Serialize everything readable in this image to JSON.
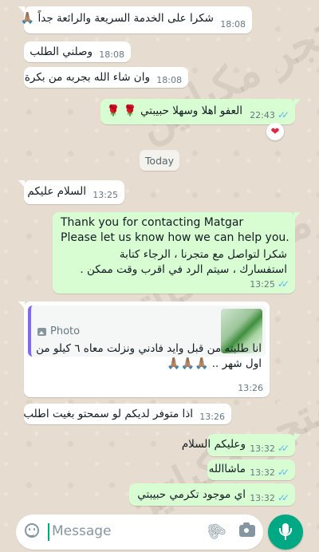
{
  "watermark": "متجر مكياتين",
  "messages": {
    "m1": {
      "text": "شكرا على الخدمة السريعة والرائعة جداً",
      "emoji": "🙏🏽",
      "time": "18:08"
    },
    "m2": {
      "text": "وصلني الطلب",
      "time": "18:08"
    },
    "m3": {
      "text": "وان شاء الله بجربه من بكرة",
      "time": "18:08"
    },
    "m4": {
      "text": "العفو اهلا وسهلا حبيبتي",
      "emoji_a": "🌹",
      "emoji_b": "🌹",
      "time": "22:43",
      "ticks": "✓✓",
      "reaction": "❤"
    },
    "m5": {
      "text": "السلام عليكم",
      "time": "13:25"
    },
    "m6": {
      "line1": "Thank you for contacting Matgar",
      "line2": "Please let us know how we can help you.",
      "line3": "شكرا لتواصل مع متجرنا ، الرجاء كتابة",
      "line4": "استفسارك ، سيتم الرد في اقرب وقت ممكن .",
      "time": "13:25",
      "ticks": "✓✓"
    },
    "m7": {
      "quote_label": "Photo",
      "line1": "انا طلبته من قبل وايد فادني ونزلت معاه ٦ كيلو من",
      "line2": "اول شهر ..",
      "emoji": "🙏🏽🙏🏽🙏🏽",
      "time": "13:26"
    },
    "m8": {
      "text": "اذا متوفر لديكم لو سمحتو بغيت اطلب",
      "time": "13:26"
    },
    "m9": {
      "text": "وعليكم السلام",
      "time": "13:32",
      "ticks": "✓✓"
    },
    "m10": {
      "text": "ماشاالله",
      "time": "13:32",
      "ticks": "✓✓"
    },
    "m11": {
      "text": "اي موجود تكرمي حبيبتي",
      "time": "13:32",
      "ticks": "✓✓"
    }
  },
  "date_divider": "Today",
  "composer": {
    "placeholder": "Message",
    "icons": [
      "emoji-icon",
      "attach-icon",
      "camera-icon",
      "mic-icon"
    ]
  },
  "colors": {
    "incoming": "#ffffff",
    "outgoing": "#d9fdd3",
    "accent": "#00a884",
    "read_ticks": "#53bdeb"
  }
}
